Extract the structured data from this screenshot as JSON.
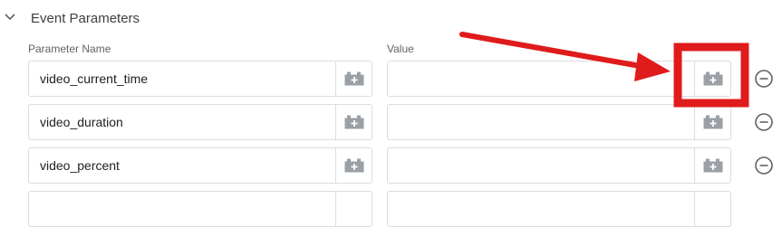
{
  "section": {
    "title": "Event Parameters"
  },
  "columns": {
    "name_label": "Parameter Name",
    "value_label": "Value"
  },
  "rows": [
    {
      "name": "video_current_time",
      "value": ""
    },
    {
      "name": "video_duration",
      "value": ""
    },
    {
      "name": "video_percent",
      "value": ""
    },
    {
      "name": "",
      "value": ""
    }
  ],
  "icons": {
    "chevron": "chevron-down-icon",
    "variable": "add-variable-icon",
    "remove": "remove-circle-icon"
  },
  "colors": {
    "annotation": "#e01b1b",
    "icon_gray": "#9aa0a6",
    "border": "#dadce0"
  }
}
